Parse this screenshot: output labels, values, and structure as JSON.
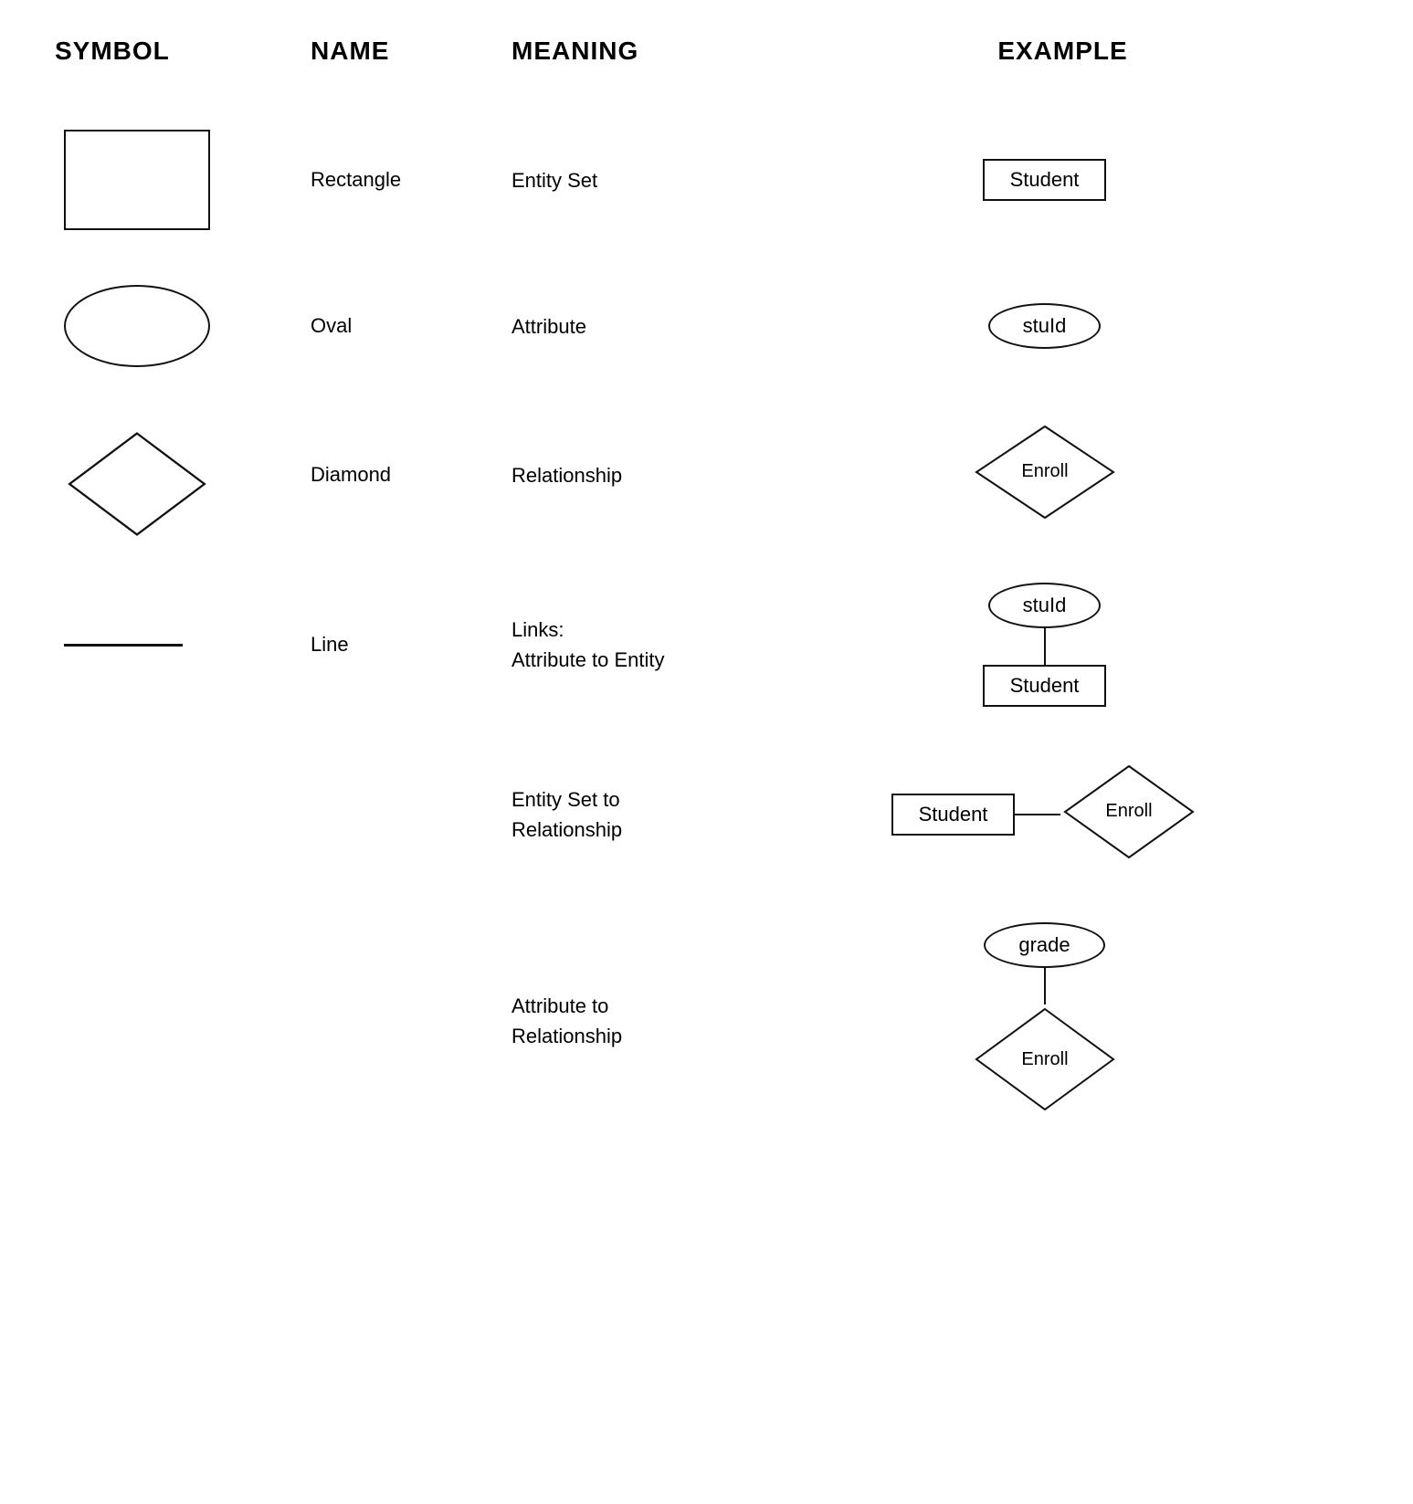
{
  "header": {
    "col1": "SYMBOL",
    "col2": "NAME",
    "col3": "MEANING",
    "col4": "EXAMPLE"
  },
  "rows": [
    {
      "id": "row-1",
      "name": "Rectangle",
      "meaning": "Entity Set",
      "example_label": "Student",
      "example_type": "rect"
    },
    {
      "id": "row-2",
      "name": "Oval",
      "meaning": "Attribute",
      "example_label": "stuId",
      "example_type": "oval"
    },
    {
      "id": "row-3",
      "name": "Diamond",
      "meaning": "Relationship",
      "example_label": "Enroll",
      "example_type": "diamond"
    },
    {
      "id": "row-4",
      "name": "Line",
      "meaning_line1": "Links:",
      "meaning_line2": "Attribute to Entity",
      "example_type": "line-attr-entity",
      "ex_top": "stuId",
      "ex_bottom": "Student"
    },
    {
      "id": "row-5",
      "meaning_line1": "Entity Set to",
      "meaning_line2": "Relationship",
      "example_type": "entity-to-rel",
      "ex_left": "Student",
      "ex_right": "Enroll"
    },
    {
      "id": "row-6",
      "meaning_line1": "Attribute to",
      "meaning_line2": "Relationship",
      "example_type": "attr-to-rel",
      "ex_top": "grade",
      "ex_bottom": "Enroll"
    }
  ]
}
